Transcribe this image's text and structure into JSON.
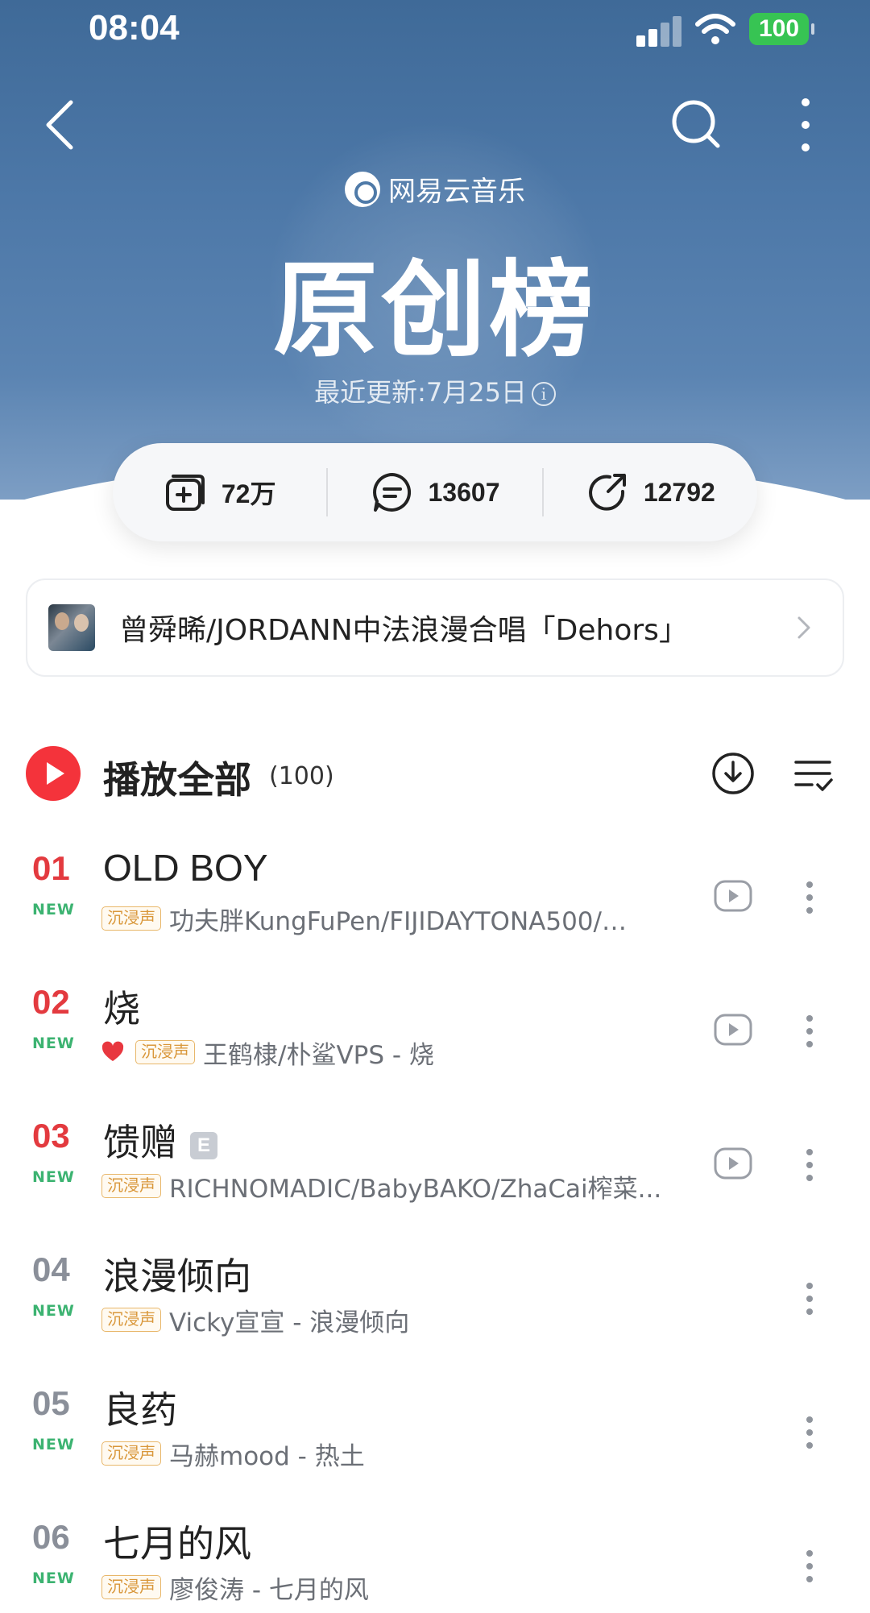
{
  "status_bar": {
    "time": "08:04",
    "battery": "100"
  },
  "header": {
    "brand": "网易云音乐",
    "title": "原创榜",
    "updated": "最近更新:7月25日",
    "info_symbol": "i"
  },
  "stats": {
    "subscribed": "72万",
    "comments": "13607",
    "shares": "12792"
  },
  "banner": {
    "text": "曾舜晞/JORDANN中法浪漫合唱「Dehors」"
  },
  "play_all": {
    "label": "播放全部",
    "count": "(100)"
  },
  "songs": [
    {
      "rank": "01",
      "tag": "NEW",
      "title": "OLD BOY",
      "quality": "沉浸声",
      "artist": "功夫胖KungFuPen/FIJIDAYTONA500/…",
      "liked": false,
      "explicit": false,
      "has_mv": true
    },
    {
      "rank": "02",
      "tag": "NEW",
      "title": "烧",
      "quality": "沉浸声",
      "artist": "王鹤棣/朴鲨VPS - 烧",
      "liked": true,
      "explicit": false,
      "has_mv": true
    },
    {
      "rank": "03",
      "tag": "NEW",
      "title": "馈赠",
      "explicit_label": "E",
      "quality": "沉浸声",
      "artist": "RICHNOMADIC/BabyBAKO/ZhaCai榨菜...",
      "liked": false,
      "explicit": true,
      "has_mv": true
    },
    {
      "rank": "04",
      "tag": "NEW",
      "title": "浪漫倾向",
      "quality": "沉浸声",
      "artist": "Vicky宣宣 - 浪漫倾向",
      "liked": false,
      "explicit": false,
      "has_mv": false
    },
    {
      "rank": "05",
      "tag": "NEW",
      "title": "良药",
      "quality": "沉浸声",
      "artist": "马赫mood - 热土",
      "liked": false,
      "explicit": false,
      "has_mv": false
    },
    {
      "rank": "06",
      "tag": "NEW",
      "title": "七月的风",
      "quality": "沉浸声",
      "artist": "廖俊涛 - 七月的风",
      "liked": false,
      "explicit": false,
      "has_mv": false
    }
  ],
  "colors": {
    "header_top": "#3f6a98",
    "accent_red": "#f4333b",
    "rank_top": "#e33a3f",
    "new_tag": "#3cb371",
    "quality_tag": "#d9973a"
  }
}
